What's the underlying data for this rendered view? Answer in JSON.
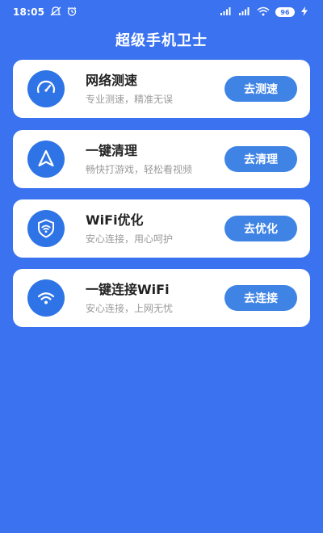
{
  "status_bar": {
    "time": "18:05",
    "battery": "96"
  },
  "header": {
    "title": "超级手机卫士"
  },
  "cards": [
    {
      "icon": "speedometer-icon",
      "title": "网络测速",
      "desc": "专业测速，精准无误",
      "button": "去测速"
    },
    {
      "icon": "navigation-arrow-icon",
      "title": "一键清理",
      "desc": "畅快打游戏，轻松看视频",
      "button": "去清理"
    },
    {
      "icon": "shield-wifi-icon",
      "title": "WiFi优化",
      "desc": "安心连接，用心呵护",
      "button": "去优化"
    },
    {
      "icon": "wifi-icon",
      "title": "一键连接WiFi",
      "desc": "安心连接，上网无忧",
      "button": "去连接"
    }
  ],
  "colors": {
    "background": "#3a72f0",
    "accent": "#3f84e5",
    "icon_bg": "#2f74e6"
  }
}
